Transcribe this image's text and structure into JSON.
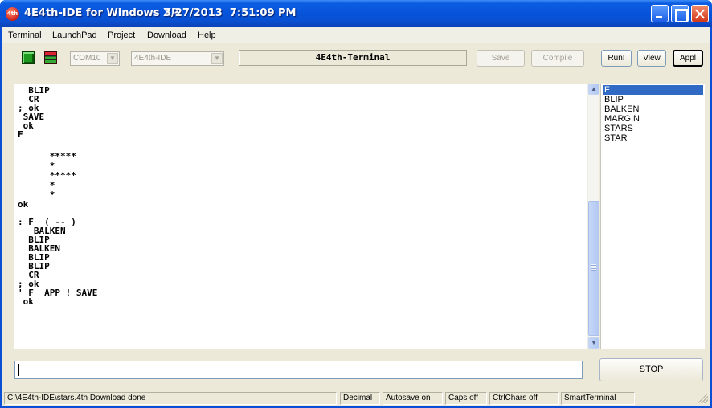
{
  "window": {
    "icon_text": "4th",
    "title": "4E4th-IDE for Windows XP",
    "datetime": "3/27/2013  7:51:09 PM"
  },
  "menu": {
    "items": [
      "Terminal",
      "LaunchPad",
      "Project",
      "Download",
      "Help"
    ]
  },
  "toolbar": {
    "com_port": "COM10",
    "target": "4E4th-IDE",
    "terminal_label": "4E4th-Terminal",
    "save_label": "Save",
    "compile_label": "Compile",
    "run_label": "Run!",
    "view_label": "View",
    "appl_label": "Appl"
  },
  "terminal": {
    "lines": [
      "  BLIP",
      "  CR",
      "; ok",
      " SAVE",
      " ok",
      "F",
      "",
      "      *****",
      "      *",
      "      *****",
      "      *",
      "      *",
      "ok",
      "",
      ": F  ( -- )",
      "   BALKEN",
      "  BLIP",
      "  BALKEN",
      "  BLIP",
      "  BLIP",
      "  CR",
      "; ok",
      "' F  APP ! SAVE",
      " ok"
    ]
  },
  "wordlist": {
    "items": [
      "F",
      "BLIP",
      "BALKEN",
      "MARGIN",
      "STARS",
      "STAR"
    ],
    "selected_index": 0
  },
  "input": {
    "value": ""
  },
  "stop_label": "STOP",
  "status": {
    "message": "C:\\4E4th-IDE\\stars.4th Download done",
    "number_base": "Decimal",
    "autosave": "Autosave on",
    "caps": "Caps off",
    "ctrlchars": "CtrlChars off",
    "terminal_mode": "SmartTerminal"
  }
}
